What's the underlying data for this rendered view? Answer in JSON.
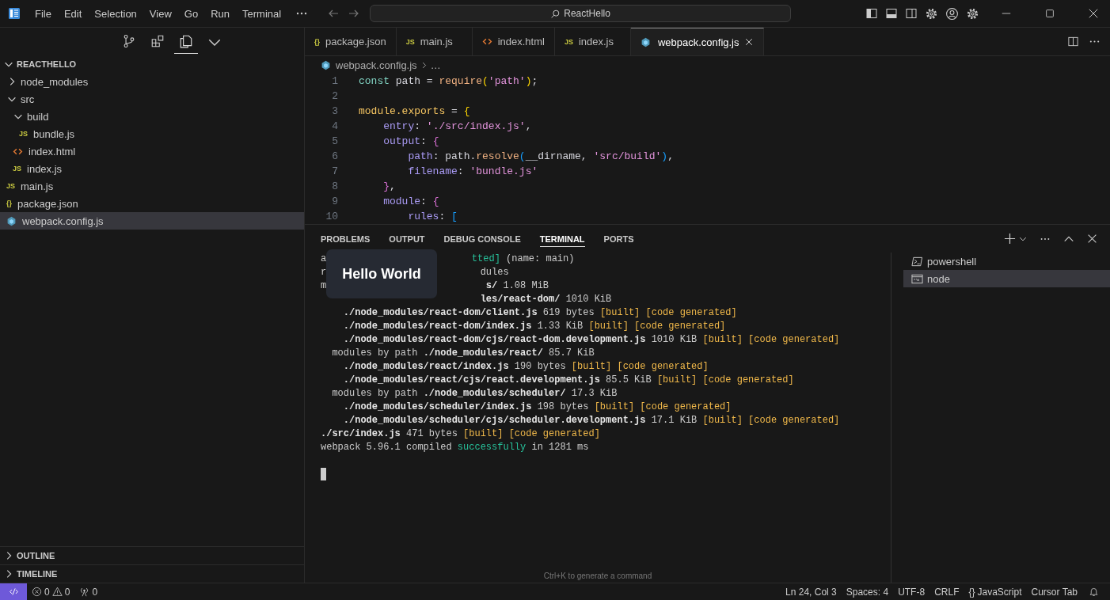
{
  "window": {
    "title": "ReactHello"
  },
  "menu": [
    "File",
    "Edit",
    "Selection",
    "View",
    "Go",
    "Run",
    "Terminal"
  ],
  "activity": [
    {
      "kind": "source-control",
      "selected": false
    },
    {
      "kind": "extensions",
      "selected": false
    },
    {
      "kind": "explorer",
      "selected": true
    }
  ],
  "explorer": {
    "title": "REACTHELLO",
    "expanded": true,
    "tree": [
      {
        "label": "node_modules",
        "kind": "folder",
        "expanded": false,
        "selected": false
      },
      {
        "label": "src",
        "kind": "folder",
        "expanded": true,
        "selected": false,
        "children": [
          {
            "label": "build",
            "kind": "folder",
            "expanded": true,
            "selected": false,
            "children": [
              {
                "label": "bundle.js",
                "kind": "js",
                "badge": "JS",
                "selected": false
              }
            ]
          },
          {
            "label": "index.html",
            "kind": "html",
            "selected": false
          },
          {
            "label": "index.js",
            "kind": "js",
            "badge": "JS",
            "selected": false
          }
        ]
      },
      {
        "label": "main.js",
        "kind": "js",
        "badge": "JS",
        "selected": false
      },
      {
        "label": "package.json",
        "kind": "json",
        "badge": "{}",
        "selected": false
      },
      {
        "label": "webpack.config.js",
        "kind": "webpack",
        "selected": true
      }
    ]
  },
  "sidebar_sections": [
    {
      "label": "OUTLINE",
      "expanded": false
    },
    {
      "label": "TIMELINE",
      "expanded": false
    }
  ],
  "editor_tabs": [
    {
      "label": "package.json",
      "kind": "json",
      "badge": "{}",
      "selected": false
    },
    {
      "label": "main.js",
      "kind": "js",
      "badge": "JS",
      "selected": false
    },
    {
      "label": "index.html",
      "kind": "html",
      "selected": false
    },
    {
      "label": "index.js",
      "kind": "js",
      "badge": "JS",
      "selected": false
    },
    {
      "label": "webpack.config.js",
      "kind": "webpack",
      "selected": true
    }
  ],
  "breadcrumb": {
    "file": "webpack.config.js",
    "kind": "webpack",
    "rest": "…"
  },
  "code": [
    {
      "number": "1",
      "tokens": [
        {
          "t": "const",
          "kind": "kw"
        },
        {
          "t": " path = ",
          "kind": "id"
        },
        {
          "t": "require",
          "kind": "fn"
        },
        {
          "t": "(",
          "kind": "b1"
        },
        {
          "t": "'path'",
          "kind": "str"
        },
        {
          "t": ")",
          "kind": "b1"
        },
        {
          "t": ";",
          "kind": "id"
        }
      ]
    },
    {
      "number": "2"
    },
    {
      "number": "3",
      "tokens": [
        {
          "t": "module.exports",
          "kind": "obj"
        },
        {
          "t": " = ",
          "kind": "id"
        },
        {
          "t": "{",
          "kind": "b1"
        }
      ]
    },
    {
      "number": "4",
      "tokens": [
        {
          "t": "    entry",
          "kind": "prop"
        },
        {
          "t": ": ",
          "kind": "id"
        },
        {
          "t": "'./src/index.js'",
          "kind": "str"
        },
        {
          "t": ",",
          "kind": "id"
        }
      ]
    },
    {
      "number": "5",
      "tokens": [
        {
          "t": "    output",
          "kind": "prop"
        },
        {
          "t": ": ",
          "kind": "id"
        },
        {
          "t": "{",
          "kind": "b2"
        }
      ]
    },
    {
      "number": "6",
      "tokens": [
        {
          "t": "        path",
          "kind": "prop"
        },
        {
          "t": ": path.",
          "kind": "id"
        },
        {
          "t": "resolve",
          "kind": "fn"
        },
        {
          "t": "(",
          "kind": "b3"
        },
        {
          "t": "__dirname, ",
          "kind": "id"
        },
        {
          "t": "'src/build'",
          "kind": "str"
        },
        {
          "t": ")",
          "kind": "b3"
        },
        {
          "t": ",",
          "kind": "id"
        }
      ]
    },
    {
      "number": "7",
      "tokens": [
        {
          "t": "        filename",
          "kind": "prop"
        },
        {
          "t": ": ",
          "kind": "id"
        },
        {
          "t": "'bundle.js'",
          "kind": "str"
        }
      ]
    },
    {
      "number": "8",
      "tokens": [
        {
          "t": "    }",
          "kind": "b2"
        },
        {
          "t": ",",
          "kind": "id"
        }
      ]
    },
    {
      "number": "9",
      "tokens": [
        {
          "t": "    module",
          "kind": "prop"
        },
        {
          "t": ": ",
          "kind": "id"
        },
        {
          "t": "{",
          "kind": "b2"
        }
      ]
    },
    {
      "number": "10",
      "tokens": [
        {
          "t": "        rules",
          "kind": "prop"
        },
        {
          "t": ": ",
          "kind": "id"
        },
        {
          "t": "[",
          "kind": "b3"
        }
      ]
    }
  ],
  "panel": {
    "tabs": [
      {
        "label": "PROBLEMS",
        "selected": false
      },
      {
        "label": "OUTPUT",
        "selected": false
      },
      {
        "label": "DEBUG CONSOLE",
        "selected": false
      },
      {
        "label": "TERMINAL",
        "selected": true
      },
      {
        "label": "PORTS",
        "selected": false
      }
    ],
    "terminal_lines": [
      {
        "left": [
          {
            "text": "a",
            "kind": "plain"
          }
        ],
        "right": [
          {
            "text": "tted]",
            "kind": "ok"
          },
          {
            "text": " (name: main)",
            "kind": "plain"
          }
        ]
      },
      {
        "left": [
          {
            "text": "r",
            "kind": "plain"
          }
        ],
        "right": [
          {
            "text": "dules",
            "kind": "plain"
          }
        ]
      },
      {
        "left": [
          {
            "text": "m",
            "kind": "plain"
          }
        ],
        "right": [
          {
            "text": "s/",
            "kind": "bold"
          },
          {
            "text": " 1.08 MiB",
            "kind": "plain"
          }
        ]
      },
      {
        "right": [
          {
            "text": "les/react-dom/",
            "kind": "bold"
          },
          {
            "text": " 1010 KiB",
            "kind": "plain"
          }
        ]
      },
      {
        "segments": [
          {
            "text": "    ./node_modules/react-dom/client.js",
            "kind": "bold"
          },
          {
            "text": " 619 bytes ",
            "kind": "plain"
          },
          {
            "text": "[built] [code generated]",
            "kind": "built"
          }
        ]
      },
      {
        "segments": [
          {
            "text": "    ./node_modules/react-dom/index.js",
            "kind": "bold"
          },
          {
            "text": " 1.33 KiB ",
            "kind": "plain"
          },
          {
            "text": "[built] [code generated]",
            "kind": "built"
          }
        ]
      },
      {
        "segments": [
          {
            "text": "    ./node_modules/react-dom/cjs/react-dom.development.js",
            "kind": "bold"
          },
          {
            "text": " 1010 KiB ",
            "kind": "plain"
          },
          {
            "text": "[built] [code generated]",
            "kind": "built"
          }
        ]
      },
      {
        "segments": [
          {
            "text": "  modules by path ",
            "kind": "plain"
          },
          {
            "text": "./node_modules/react/",
            "kind": "bold"
          },
          {
            "text": " 85.7 KiB",
            "kind": "plain"
          }
        ]
      },
      {
        "segments": [
          {
            "text": "    ./node_modules/react/index.js",
            "kind": "bold"
          },
          {
            "text": " 190 bytes ",
            "kind": "plain"
          },
          {
            "text": "[built] [code generated]",
            "kind": "built"
          }
        ]
      },
      {
        "segments": [
          {
            "text": "    ./node_modules/react/cjs/react.development.js",
            "kind": "bold"
          },
          {
            "text": " 85.5 KiB ",
            "kind": "plain"
          },
          {
            "text": "[built] [code generated]",
            "kind": "built"
          }
        ]
      },
      {
        "segments": [
          {
            "text": "  modules by path ",
            "kind": "plain"
          },
          {
            "text": "./node_modules/scheduler/",
            "kind": "bold"
          },
          {
            "text": " 17.3 KiB",
            "kind": "plain"
          }
        ]
      },
      {
        "segments": [
          {
            "text": "    ./node_modules/scheduler/index.js",
            "kind": "bold"
          },
          {
            "text": " 198 bytes ",
            "kind": "plain"
          },
          {
            "text": "[built] [code generated]",
            "kind": "built"
          }
        ]
      },
      {
        "segments": [
          {
            "text": "    ./node_modules/scheduler/cjs/scheduler.development.js",
            "kind": "bold"
          },
          {
            "text": " 17.1 KiB ",
            "kind": "plain"
          },
          {
            "text": "[built] [code generated]",
            "kind": "built"
          }
        ]
      },
      {
        "segments": [
          {
            "text": "./src/index.js",
            "kind": "bold"
          },
          {
            "text": " 471 bytes ",
            "kind": "plain"
          },
          {
            "text": "[built] [code generated]",
            "kind": "built"
          }
        ]
      },
      {
        "segments": [
          {
            "text": "webpack 5.96.1 compiled ",
            "kind": "plain"
          },
          {
            "text": "successfully",
            "kind": "ok"
          },
          {
            "text": " in 1281 ms",
            "kind": "plain"
          }
        ]
      }
    ],
    "terminal_hint": "Ctrl+K to generate a command",
    "terminals": [
      {
        "label": "powershell",
        "kind": "powershell",
        "selected": false
      },
      {
        "label": "node",
        "kind": "cmd",
        "selected": true
      }
    ]
  },
  "popup": {
    "title": "Hello World"
  },
  "status_bar": {
    "errors": "0",
    "warnings": "0",
    "ports": "0",
    "items": [
      "Ln 24, Col 3",
      "Spaces: 4",
      "UTF-8",
      "CRLF"
    ],
    "language_icon": "{}",
    "language": "JavaScript",
    "extra": "Cursor Tab"
  }
}
